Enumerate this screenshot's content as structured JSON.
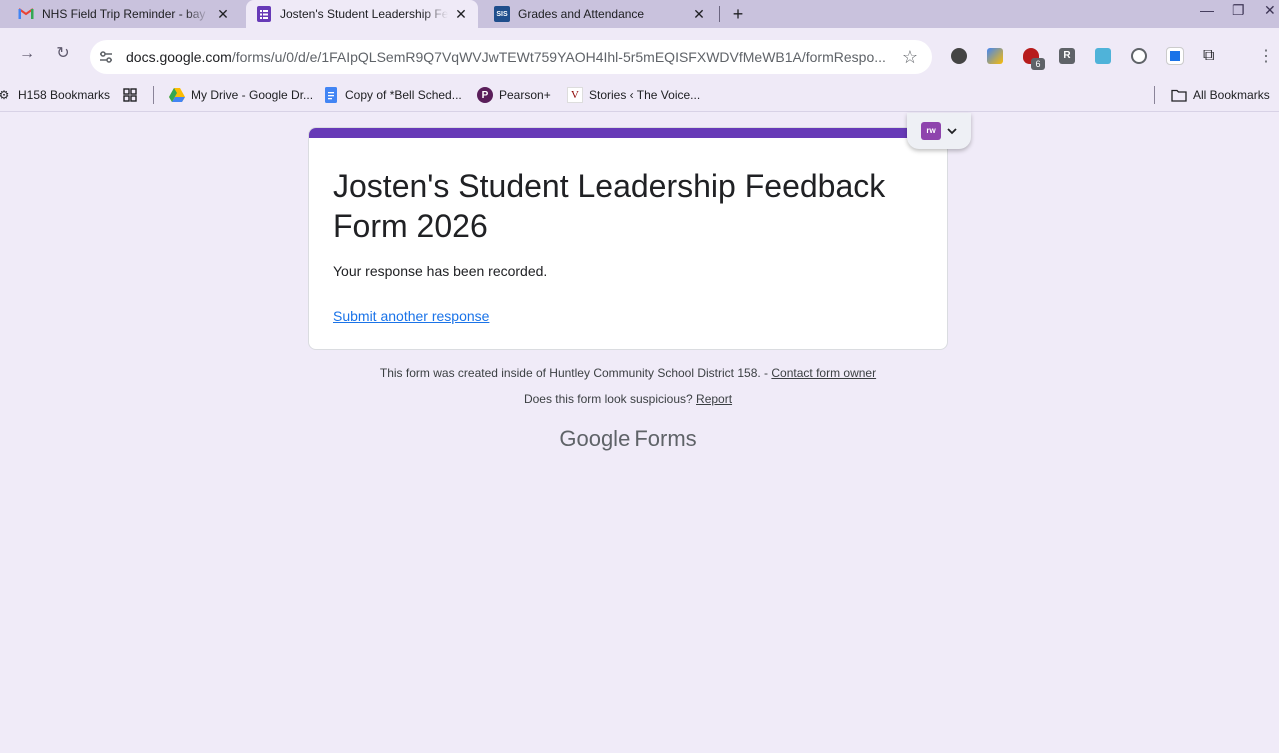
{
  "tabs": [
    {
      "title": "NHS Field Trip Reminder - bay",
      "icon": "gmail-icon"
    },
    {
      "title": "Josten's Student Leadership Fe",
      "icon": "google-forms-icon",
      "active": true
    },
    {
      "title": "Grades and Attendance",
      "icon": "sis-icon",
      "icon_text": "SIS"
    }
  ],
  "omnibox": {
    "host": "docs.google.com",
    "path": "/forms/u/0/d/e/1FAIpQLSemR9Q7VqWVJwTEWt759YAOH4Ihl-5r5mEQISFXWDVfMeWB1A/formRespo..."
  },
  "extensions": {
    "badge_count": "6",
    "r_label": "R"
  },
  "bookmarks": [
    {
      "label": "H158 Bookmarks",
      "icon": "settings-icon"
    },
    {
      "label": "",
      "icon": "apps-grid-icon"
    },
    {
      "label": "My Drive - Google Dr...",
      "icon": "google-drive-icon"
    },
    {
      "label": "Copy of *Bell Sched...",
      "icon": "google-docs-icon"
    },
    {
      "label": "Pearson+",
      "icon": "pearson-icon",
      "icon_text": "P"
    },
    {
      "label": "Stories ‹ The Voice...",
      "icon": "the-voice-icon",
      "icon_text": "V"
    }
  ],
  "all_bookmarks": "All Bookmarks",
  "form": {
    "title": "Josten's Student Leadership Feedback Form 2026",
    "message": "Your response has been recorded.",
    "submit_another": "Submit another response",
    "accent_color": "#673ab7"
  },
  "footer": {
    "created_text": "This form was created inside of Huntley Community School District 158. -",
    "contact_link": "Contact form owner",
    "suspicious_text": "Does this form look suspicious?",
    "report_link": "Report"
  },
  "brand": {
    "google": "Google",
    "forms": "Forms"
  },
  "floating_extension": {
    "label": "rw"
  }
}
